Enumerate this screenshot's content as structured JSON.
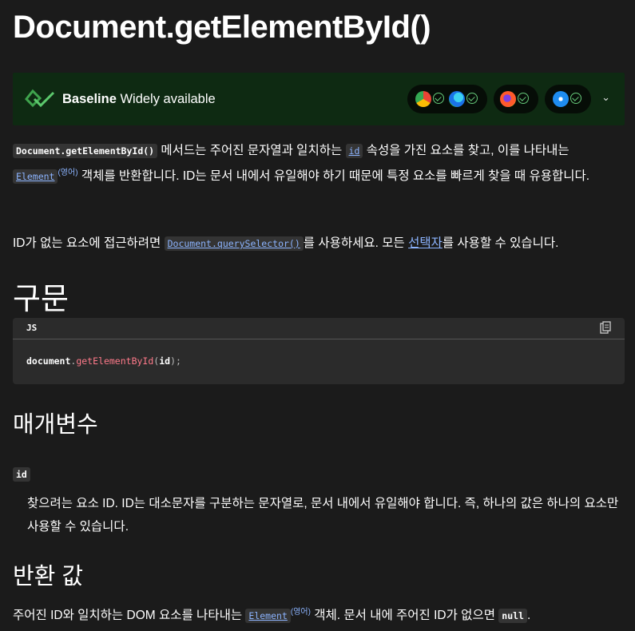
{
  "title": "Document.getElementById()",
  "baseline": {
    "label_bold": "Baseline",
    "label_rest": " Widely available",
    "browsers": [
      "chrome-icon",
      "edge-icon",
      "firefox-icon",
      "safari-icon"
    ]
  },
  "intro": {
    "code_method": "Document.getElementById()",
    "text1": " 메서드는 주어진 문자열과 일치하는 ",
    "code_id": "id",
    "text2": " 속성을 가진 요소를 찾고, 이를 나타내는 ",
    "code_element": "Element",
    "sup_lang": "(영어)",
    "text3": " 객체를 반환합니다. ID는 문서 내에서 유일해야 하기 때문에 특정 요소를 빠르게 찾을 때 유용합니다."
  },
  "para2": {
    "text1": "ID가 없는 요소에 접근하려면 ",
    "code_qs": "Document.querySelector()",
    "text2": "를 사용하세요. 모든 ",
    "link_selector": "선택자",
    "text3": "를 사용할 수 있습니다."
  },
  "syntax": {
    "heading": "구문",
    "lang": "JS",
    "code_obj": "document",
    "code_dot": ".",
    "code_fn": "getElementById",
    "code_paren_open": "(",
    "code_arg": "id",
    "code_paren_close": ");"
  },
  "params": {
    "heading": "매개변수",
    "name": "id",
    "desc": "찾으려는 요소 ID. ID는 대소문자를 구분하는 문자열로, 문서 내에서 유일해야 합니다. 즉, 하나의 값은 하나의 요소만 사용할 수 있습니다."
  },
  "returns": {
    "heading": "반환 값",
    "text1": "주어진 ID와 일치하는 DOM 요소를 나타내는 ",
    "code_element": "Element",
    "sup_lang": "(영어)",
    "text2": " 객체. 문서 내에 주어진 ID가 없으면 ",
    "code_null": "null",
    "text3": "."
  },
  "colors": {
    "background": "#1b1b1b",
    "baseline_bg": "#0e2a12",
    "link": "#8cb4ff",
    "check": "#66c97a"
  }
}
